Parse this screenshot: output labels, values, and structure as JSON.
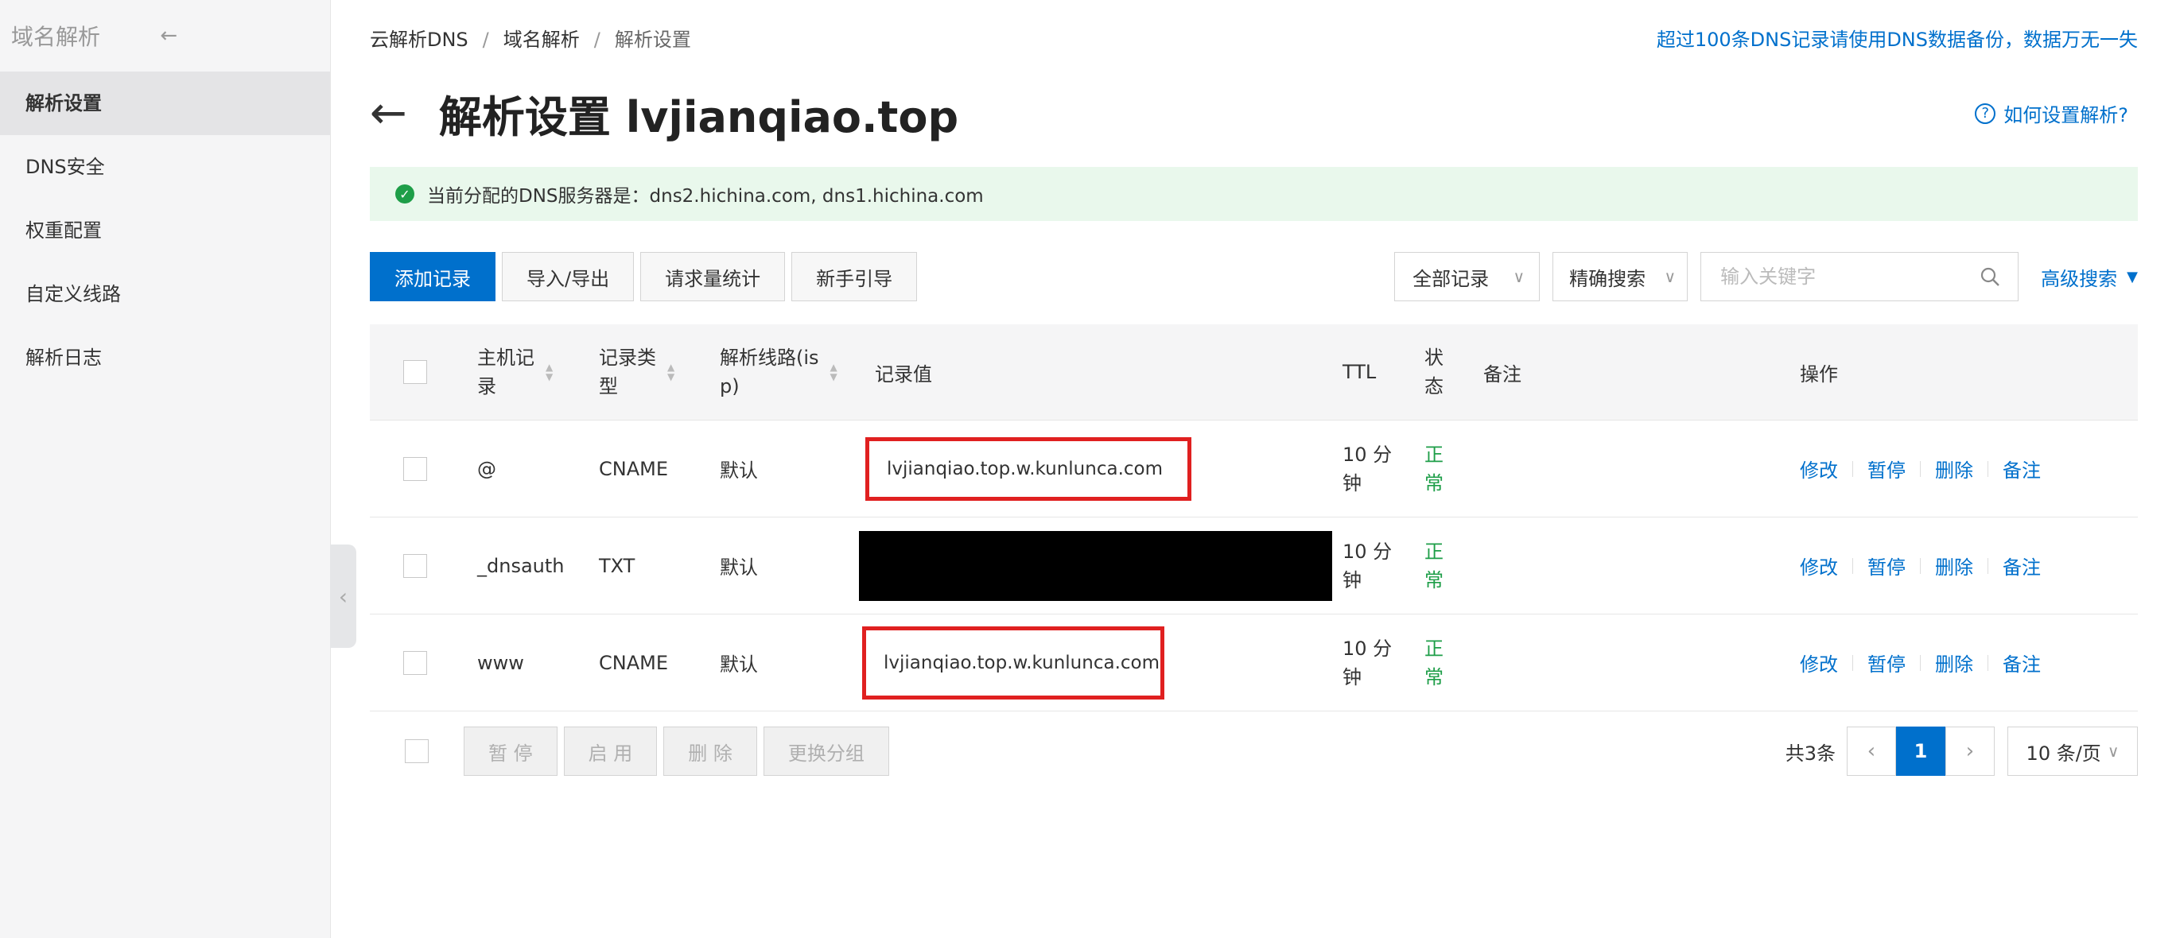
{
  "sidebar": {
    "title": "域名解析",
    "items": [
      {
        "label": "解析设置"
      },
      {
        "label": "DNS安全"
      },
      {
        "label": "权重配置"
      },
      {
        "label": "自定义线路"
      },
      {
        "label": "解析日志"
      }
    ]
  },
  "breadcrumb": {
    "items": [
      "云解析DNS",
      "域名解析",
      "解析设置"
    ]
  },
  "top_notice": "超过100条DNS记录请使用DNS数据备份，数据万无一失",
  "page": {
    "title": "解析设置 lvjianqiao.top",
    "help": "如何设置解析?"
  },
  "notice": {
    "text": "当前分配的DNS服务器是：dns2.hichina.com, dns1.hichina.com"
  },
  "toolbar": {
    "add": "添加记录",
    "import_export": "导入/导出",
    "stats": "请求量统计",
    "guide": "新手引导",
    "filter": "全部记录",
    "search_mode": "精确搜索",
    "search_placeholder": "输入关键字",
    "advanced": "高级搜索"
  },
  "table": {
    "headers": {
      "host": "主机记\n录",
      "type": "记录类\n型",
      "line": "解析线路(is\np)",
      "value": "记录值",
      "ttl": "TTL",
      "status": "状\n态",
      "note": "备注",
      "ops": "操作"
    },
    "rows": [
      {
        "host": "@",
        "type": "CNAME",
        "line": "默认",
        "value": "lvjianqiao.top.w.kunlunca.com",
        "ttl": "10 分\n钟",
        "status": "正\n常"
      },
      {
        "host": "_dnsauth",
        "type": "TXT",
        "line": "默认",
        "value": "",
        "ttl": "10 分\n钟",
        "status": "正\n常"
      },
      {
        "host": "www",
        "type": "CNAME",
        "line": "默认",
        "value": "lvjianqiao.top.w.kunlunca.com",
        "ttl": "10 分\n钟",
        "status": "正\n常"
      }
    ],
    "actions": [
      "修改",
      "暂停",
      "删除",
      "备注"
    ]
  },
  "footer": {
    "pause": "暂 停",
    "enable": "启 用",
    "delete": "删 除",
    "change_group": "更换分组",
    "total": "共3条",
    "current_page": "1",
    "page_size": "10 条/页"
  },
  "colors": {
    "accent": "#0070cc",
    "success": "#1e9e48",
    "highlight": "#e02020"
  }
}
